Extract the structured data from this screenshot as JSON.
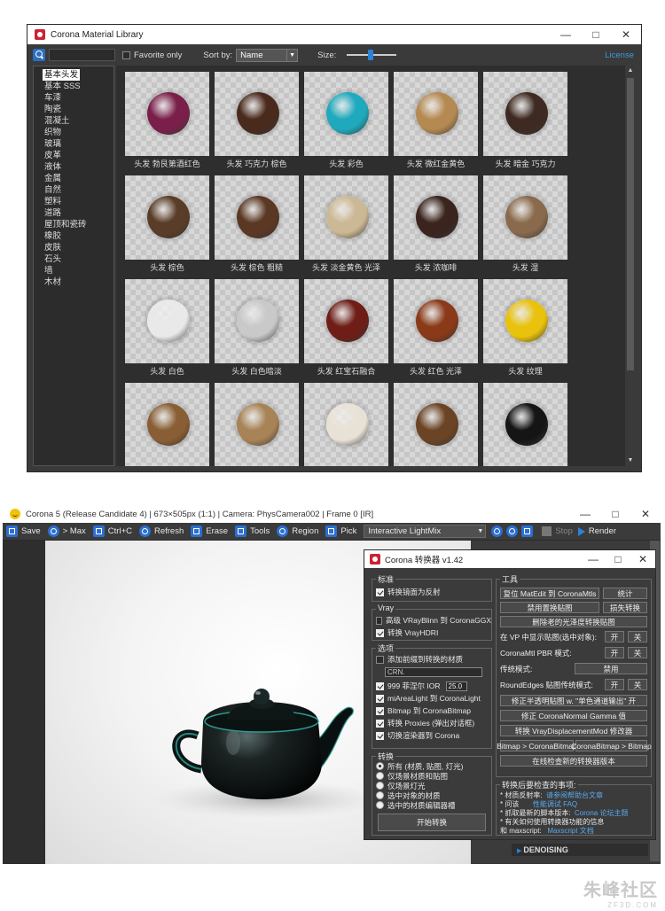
{
  "library": {
    "title": "Corona Material Library",
    "favorite_label": "Favorite only",
    "sort_label": "Sort by:",
    "sort_value": "Name",
    "size_label": "Size:",
    "license": "License",
    "categories": [
      "基本头发",
      "基本 SSS",
      "车漆",
      "陶瓷",
      "混凝土",
      "织物",
      "玻璃",
      "皮革",
      "液体",
      "金属",
      "自然",
      "塑料",
      "道路",
      "屋顶和瓷砖",
      "橡胶",
      "皮肤",
      "石头",
      "墙",
      "木材"
    ],
    "materials": [
      {
        "label": "头发 勃艮第酒红色",
        "color": "#7a1f4a"
      },
      {
        "label": "头发 巧克力 棕色",
        "color": "#4a2a1c"
      },
      {
        "label": "头发 彩色",
        "color": "#1fa9bd"
      },
      {
        "label": "头发 微红金黄色",
        "color": "#b58a52"
      },
      {
        "label": "头发 暗金 巧克力",
        "color": "#3e2a22"
      },
      {
        "label": "头发 棕色",
        "color": "#5a3d28"
      },
      {
        "label": "头发 棕色 粗糙",
        "color": "#5b3824"
      },
      {
        "label": "头发 淡金黄色 光泽",
        "color": "#cbb894"
      },
      {
        "label": "头发 浓咖啡",
        "color": "#3a241d"
      },
      {
        "label": "头发 湿",
        "color": "#8a6a4c"
      },
      {
        "label": "头发 白色",
        "color": "#e9e9e9"
      },
      {
        "label": "头发 白色暗淡",
        "color": "#c9c9c9"
      },
      {
        "label": "头发 红宝石融合",
        "color": "#6e1e16"
      },
      {
        "label": "头发 红色 光泽",
        "color": "#8a3a18"
      },
      {
        "label": "头发 纹理",
        "color": "#e9c20d"
      },
      {
        "label": "",
        "color": "#8a5e34"
      },
      {
        "label": "",
        "color": "#a88356"
      },
      {
        "label": "",
        "color": "#e8e2d6"
      },
      {
        "label": "",
        "color": "#6b4426"
      },
      {
        "label": "",
        "color": "#151515"
      }
    ]
  },
  "framebuffer": {
    "title": "Corona 5 (Release Candidate 4) | 673×505px (1:1) | Camera: PhysCamera002 | Frame 0 [IR]",
    "save": "Save",
    "to_max": "> Max",
    "ctrl_c": "Ctrl+C",
    "refresh": "Refresh",
    "erase": "Erase",
    "tools": "Tools",
    "region": "Region",
    "pick": "Pick",
    "lightmix": "Interactive LightMix",
    "stop": "Stop",
    "render": "Render",
    "denoising": "DENOISING"
  },
  "converter": {
    "title": "Corona 转换器 v1.42",
    "g_std": "标准",
    "std_reflect": "转换镜面为反射",
    "g_vray": "Vray",
    "vray_blinn": "高级 VRayBlinn 到 CoronaGGX",
    "vray_hdri": "转换 VrayHDRI",
    "g_opts": "选项",
    "opt_prefix": "添加前缀到转换的材质",
    "opt_prefix_val": "CRN.",
    "opt_ior": "999 菲涅尔 IOR",
    "opt_ior_val": "25.0",
    "opt_mia": "miAreaLight 到 CoronaLight",
    "opt_bitmap": "Bitmap 到 CoronaBitmap",
    "opt_proxy": "转换 Proxies (弹出对话框)",
    "opt_renderer": "切换渲染器到 Corona",
    "g_conv": "转换",
    "r1": "所有 (材质, 贴图, 灯光)",
    "r2": "仅场景材质和贴图",
    "r3": "仅场景灯光",
    "r4": "选中对象的材质",
    "r5": "选中的材质编辑器槽",
    "start": "开始转换",
    "g_tools": "工具",
    "t_reset": "复位 MatEdit 到 CoronaMtls",
    "t_stats": "统计",
    "t_disable_disp": "禁用置换贴图",
    "t_fix_tex": "损失转换",
    "t_delete": "删除老的光泽度转换贴图",
    "t_vp": "在 VP 中显示贴图(选中对象):",
    "t_on": "开",
    "t_off": "关",
    "t_pbr": "CoronaMtl PBR 模式:",
    "t_legacy": "传统模式:",
    "t_disable": "禁用",
    "t_roundedges": "RoundEdges 贴图传统模式:",
    "t_fix_opacity": "修正半透明贴图 w. \"单色通道输出\" 开",
    "t_fix_gamma": "修正 CoronaNormal Gamma 值",
    "t_vraydisp": "转换 VrayDisplacementMod 修改器",
    "t_bm2cb": "Bitmap > CoronaBitmap",
    "t_cb2bm": "CoronaBitmap > Bitmap",
    "t_check": "在线检查新的转换器版本",
    "g_notes": "转换后要检查的事项:",
    "n1": "* 材质反射率:",
    "n1_link": "请参阅帮助台文章",
    "n2": "* 问该",
    "n2_link": "性能调试 FAQ",
    "n3": "* 抓取最新的脚本版本:",
    "n3_link": "Corona 论坛主题",
    "n4": "* 有关如何使用转换器功能的信息",
    "n5": "和 maxscript:",
    "n5_link": "Maxscript 文档"
  },
  "watermark": {
    "main": "朱峰社区",
    "sub": "ZF3D.COM"
  }
}
